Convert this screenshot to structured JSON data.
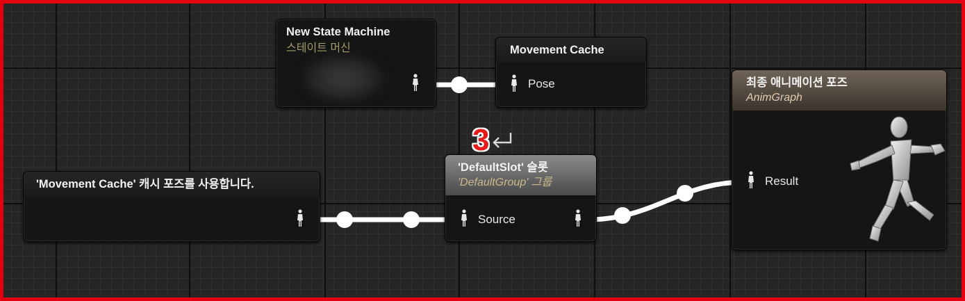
{
  "nodes": {
    "state_machine": {
      "title": "New State Machine",
      "subtitle": "스테이트 머신"
    },
    "movement_cache": {
      "title": "Movement Cache",
      "pose_label": "Pose"
    },
    "use_cache": {
      "title": "'Movement Cache' 캐시 포즈를 사용합니다."
    },
    "default_slot": {
      "title": "'DefaultSlot' 슬롯",
      "subtitle": "'DefaultGroup' 그룹",
      "source_label": "Source"
    },
    "final_pose": {
      "title": "최종 애니메이션 포즈",
      "subtitle": "AnimGraph",
      "result_label": "Result"
    }
  },
  "annotation": {
    "step": "3"
  },
  "colors": {
    "frame": "#e4000f",
    "wire": "#ffffff",
    "subtitle_state_machine": "#a39a6b",
    "subtitle_slot": "#c9b98a",
    "subtitle_animgraph": "#e2cdb2"
  },
  "icons": {
    "pin": "pose-pin-icon",
    "mannequin": "running-mannequin-icon",
    "enter": "enter-arrow-icon"
  }
}
